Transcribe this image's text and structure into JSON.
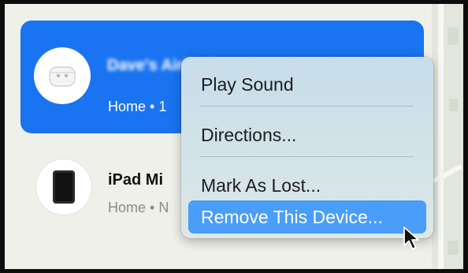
{
  "devices": [
    {
      "name": "Dave's AirPods",
      "subtitle": "Home • 1",
      "icon": "airpods-case-icon",
      "selected": true
    },
    {
      "name": "iPad Mi",
      "subtitle": "Home • N",
      "icon": "ipad-icon",
      "selected": false
    }
  ],
  "context_menu": {
    "items": [
      {
        "label": "Play Sound"
      },
      {
        "label": "Directions..."
      },
      {
        "label": "Mark As Lost..."
      },
      {
        "label": "Remove This Device...",
        "highlighted": true
      }
    ]
  },
  "colors": {
    "selection_blue": "#1a73f0",
    "menu_highlight": "#4a9df8",
    "sidebar_bg": "#eef0e9"
  }
}
